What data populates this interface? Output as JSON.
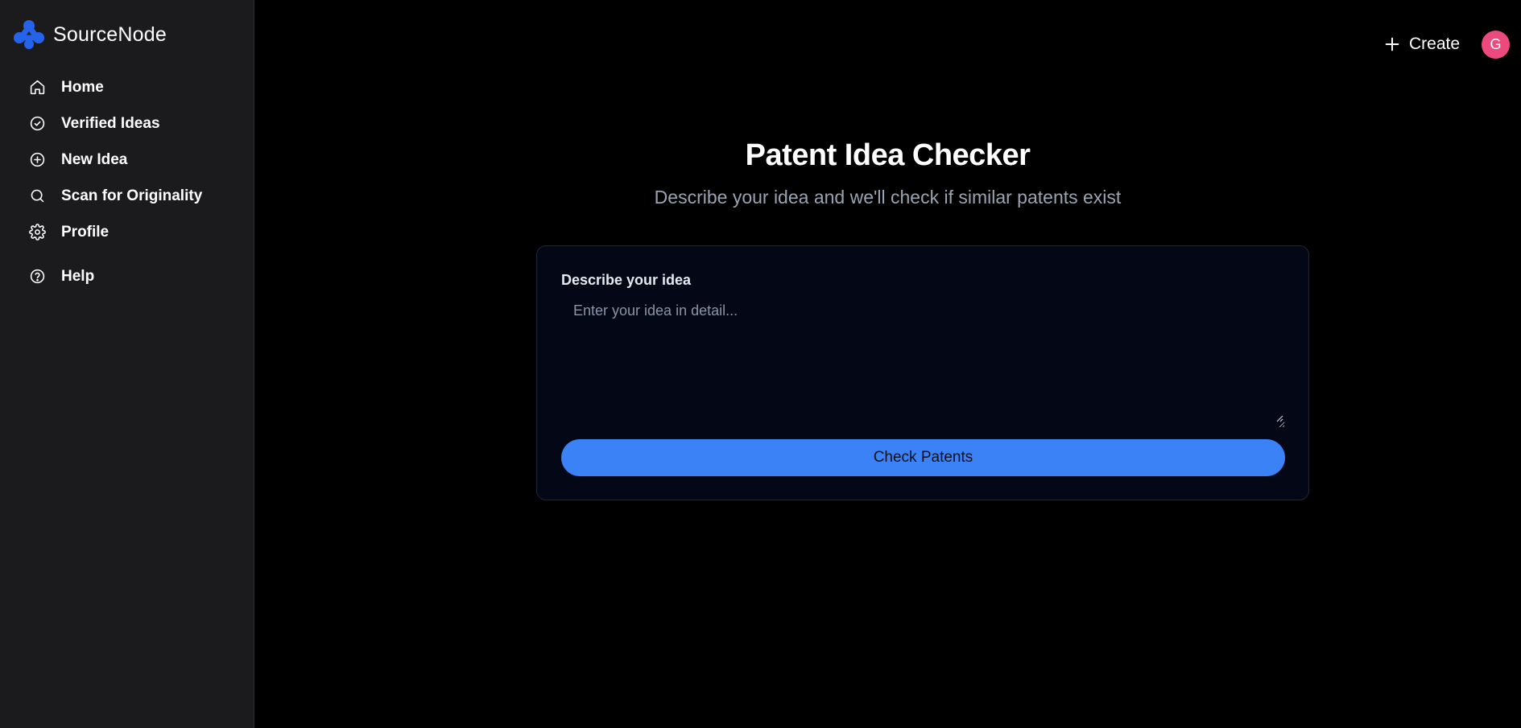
{
  "brand": {
    "name": "SourceNode",
    "logo_icon": "sourcenode-logo-icon",
    "accent_color": "#2563eb"
  },
  "sidebar": {
    "items": [
      {
        "label": "Home",
        "icon": "home-icon"
      },
      {
        "label": "Verified Ideas",
        "icon": "check-circle-icon"
      },
      {
        "label": "New Idea",
        "icon": "plus-circle-icon"
      },
      {
        "label": "Scan for Originality",
        "icon": "search-icon"
      },
      {
        "label": "Profile",
        "icon": "gear-icon"
      },
      {
        "label": "Help",
        "icon": "help-circle-icon"
      }
    ]
  },
  "header": {
    "create_label": "Create",
    "create_icon": "plus-icon",
    "avatar_initial": "G",
    "avatar_color": "#ec4a7e"
  },
  "main": {
    "title": "Patent Idea Checker",
    "subtitle": "Describe your idea and we'll check if similar patents exist",
    "form": {
      "field_label": "Describe your idea",
      "placeholder": "Enter your idea in detail...",
      "value": "",
      "submit_label": "Check Patents",
      "button_color": "#3b82f6"
    }
  }
}
